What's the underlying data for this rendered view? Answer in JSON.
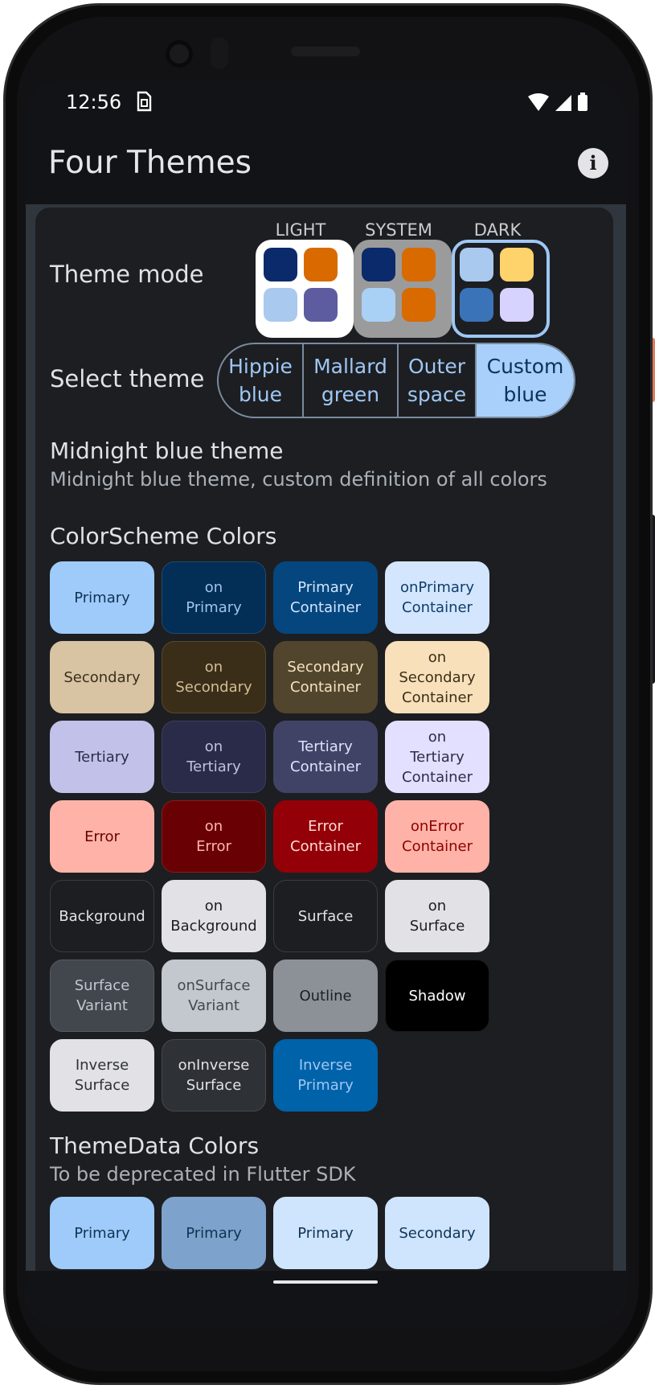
{
  "status": {
    "time": "12:56"
  },
  "appbar": {
    "title": "Four Themes",
    "info_icon": "info-icon"
  },
  "theme_mode": {
    "label": "Theme mode",
    "options": [
      {
        "label": "LIGHT",
        "bg": "#ffffff",
        "border": "#ffffff",
        "swatches": [
          "#0b2a6b",
          "#d86a00",
          "#a9c9ef",
          "#5d5ca0"
        ]
      },
      {
        "label": "SYSTEM",
        "bg": "#9b9b9b",
        "border": "#9b9b9b",
        "swatches": [
          "#0b2a6b",
          "#d86a00",
          "#a9d0f5",
          "#d86a00"
        ]
      },
      {
        "label": "DARK",
        "bg": "#1d1e21",
        "border": "#9ec7f4",
        "swatches": [
          "#a9c9ef",
          "#ffd36b",
          "#3b73b8",
          "#d7d3ff"
        ]
      }
    ],
    "selected": "DARK"
  },
  "select_theme": {
    "label": "Select theme",
    "options": [
      "Hippie\nblue",
      "Mallard\ngreen",
      "Outer\nspace",
      "Custom\nblue"
    ],
    "selected_index": 3
  },
  "theme_info": {
    "name": "Midnight blue theme",
    "description": "Midnight blue theme, custom definition of all colors"
  },
  "colorscheme": {
    "title": "ColorScheme Colors",
    "tiles": [
      {
        "label": "Primary",
        "bg": "#9fcbfb",
        "fg": "#0f3456",
        "border": "#9fcbfb"
      },
      {
        "label": "on\nPrimary",
        "bg": "#032e56",
        "fg": "#9fc4ee",
        "border": "#1c4a72"
      },
      {
        "label": "Primary\nContainer",
        "bg": "#05467e",
        "fg": "#d3e6fd",
        "border": "#05467e"
      },
      {
        "label": "onPrimary\nContainer",
        "bg": "#d4e6fe",
        "fg": "#0c3e6c",
        "border": "#d4e6fe"
      },
      {
        "label": "Secondary",
        "bg": "#d8c3a2",
        "fg": "#3a2f1e",
        "border": "#d8c3a2"
      },
      {
        "label": "on\nSecondary",
        "bg": "#3a2e18",
        "fg": "#d3bd97",
        "border": "#57482d"
      },
      {
        "label": "Secondary\nContainer",
        "bg": "#52452d",
        "fg": "#f5e2bf",
        "border": "#52452d"
      },
      {
        "label": "on\nSecondary\nContainer",
        "bg": "#f8e0bb",
        "fg": "#3c2f17",
        "border": "#f8e0bb"
      },
      {
        "label": "Tertiary",
        "bg": "#c2c1e9",
        "fg": "#2c2c4a",
        "border": "#c2c1e9"
      },
      {
        "label": "on\nTertiary",
        "bg": "#2a2b48",
        "fg": "#c0c0e2",
        "border": "#3d3e60"
      },
      {
        "label": "Tertiary\nContainer",
        "bg": "#414366",
        "fg": "#e2e1ff",
        "border": "#414366"
      },
      {
        "label": "on\nTertiary\nContainer",
        "bg": "#e2e0fe",
        "fg": "#2d2d4b",
        "border": "#e2e0fe"
      },
      {
        "label": "Error",
        "bg": "#ffb3a8",
        "fg": "#6a0000",
        "border": "#ffb3a8"
      },
      {
        "label": "on\nError",
        "bg": "#690004",
        "fg": "#ffb4a9",
        "border": "#8a1a1a"
      },
      {
        "label": "Error\nContainer",
        "bg": "#930008",
        "fg": "#ffd9d3",
        "border": "#930008"
      },
      {
        "label": "onError\nContainer",
        "bg": "#ffb3a8",
        "fg": "#8e0000",
        "border": "#ffb3a8"
      },
      {
        "label": "Background",
        "bg": "#1d1e21",
        "fg": "#e2e3e6",
        "border": "#3a3c40"
      },
      {
        "label": "on\nBackground",
        "bg": "#e2e2e6",
        "fg": "#1d1e21",
        "border": "#e2e2e6"
      },
      {
        "label": "Surface",
        "bg": "#1d1e21",
        "fg": "#e2e3e6",
        "border": "#3a3c40"
      },
      {
        "label": "on\nSurface",
        "bg": "#e2e2e6",
        "fg": "#1d1e21",
        "border": "#e2e2e6"
      },
      {
        "label": "Surface\nVariant",
        "bg": "#42474e",
        "fg": "#c3c7cf",
        "border": "#565b62"
      },
      {
        "label": "onSurface\nVariant",
        "bg": "#c3c7ce",
        "fg": "#43474e",
        "border": "#c3c7ce"
      },
      {
        "label": "Outline",
        "bg": "#8c9198",
        "fg": "#1d1e21",
        "border": "#8c9198"
      },
      {
        "label": "Shadow",
        "bg": "#000000",
        "fg": "#ffffff",
        "border": "#1a1a1a"
      },
      {
        "label": "Inverse\nSurface",
        "bg": "#e2e2e6",
        "fg": "#2e3135",
        "border": "#e2e2e6"
      },
      {
        "label": "onInverse\nSurface",
        "bg": "#2e3135",
        "fg": "#e2e2e6",
        "border": "#45484c"
      },
      {
        "label": "Inverse\nPrimary",
        "bg": "#0062a8",
        "fg": "#9ec7f4",
        "border": "#0062a8"
      }
    ]
  },
  "themedata": {
    "title": "ThemeData Colors",
    "subtitle": "To be deprecated in Flutter SDK",
    "tiles": [
      {
        "label": "Primary",
        "bg": "#9fcbfb",
        "fg": "#0f3456",
        "border": "#9fcbfb"
      },
      {
        "label": "Primary",
        "bg": "#7da3cc",
        "fg": "#0f3456",
        "border": "#7da3cc"
      },
      {
        "label": "Primary",
        "bg": "#cfe4fd",
        "fg": "#0f3456",
        "border": "#cfe4fd"
      },
      {
        "label": "Secondary",
        "bg": "#cfe4fd",
        "fg": "#0f3456",
        "border": "#cfe4fd"
      }
    ]
  }
}
